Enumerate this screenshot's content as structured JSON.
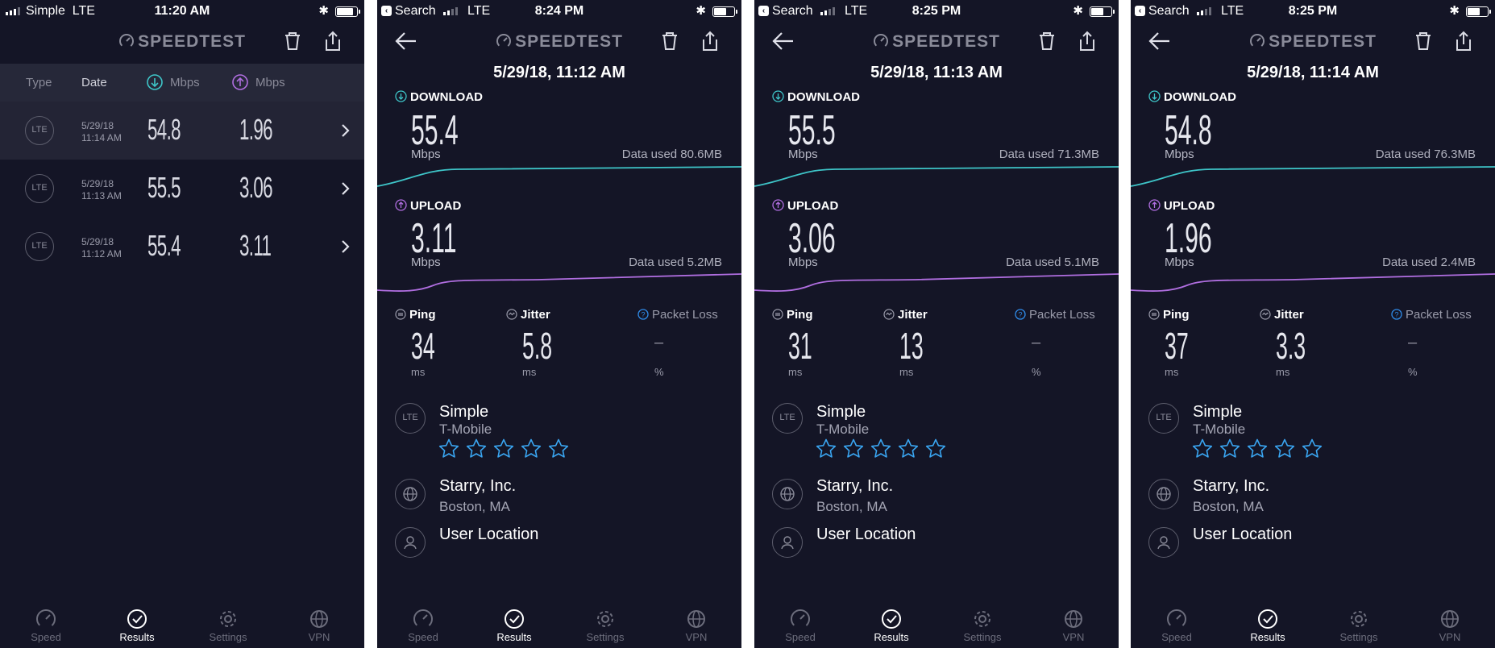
{
  "colors": {
    "background": "#141526",
    "download": "#3ec5c8",
    "upload": "#b06ee0",
    "star": "#3aa6f2",
    "accent": "#2f8be8"
  },
  "app_name": "SPEEDTEST",
  "list_screen": {
    "status": {
      "carrier": "Simple",
      "network": "LTE",
      "time": "11:20 AM"
    },
    "columns": {
      "type": "Type",
      "date": "Date",
      "download": "Mbps",
      "upload": "Mbps"
    },
    "rows": [
      {
        "badge": "LTE",
        "date": "5/29/18",
        "time": "11:14 AM",
        "download": "54.8",
        "upload": "1.96"
      },
      {
        "badge": "LTE",
        "date": "5/29/18",
        "time": "11:13 AM",
        "download": "55.5",
        "upload": "3.06"
      },
      {
        "badge": "LTE",
        "date": "5/29/18",
        "time": "11:12 AM",
        "download": "55.4",
        "upload": "3.11"
      }
    ]
  },
  "details": [
    {
      "status": {
        "back_app": "Search",
        "network": "LTE",
        "time": "8:24 PM"
      },
      "datetime": "5/29/18, 11:12 AM",
      "download_label": "DOWNLOAD",
      "download": "55.4",
      "download_unit": "Mbps",
      "download_data": "Data used 80.6MB",
      "upload_label": "UPLOAD",
      "upload": "3.11",
      "upload_unit": "Mbps",
      "upload_data": "Data used 5.2MB",
      "ping_label": "Ping",
      "ping": "34",
      "ping_unit": "ms",
      "jitter_label": "Jitter",
      "jitter": "5.8",
      "jitter_unit": "ms",
      "loss_label": "Packet Loss",
      "loss": "–",
      "loss_unit": "%",
      "badge": "LTE",
      "carrier": "Simple",
      "carrier_network": "T-Mobile",
      "rating": 5,
      "server": "Starry, Inc.",
      "server_city": "Boston, MA",
      "user_location": "User Location"
    },
    {
      "status": {
        "back_app": "Search",
        "network": "LTE",
        "time": "8:25 PM"
      },
      "datetime": "5/29/18, 11:13 AM",
      "download_label": "DOWNLOAD",
      "download": "55.5",
      "download_unit": "Mbps",
      "download_data": "Data used 71.3MB",
      "upload_label": "UPLOAD",
      "upload": "3.06",
      "upload_unit": "Mbps",
      "upload_data": "Data used 5.1MB",
      "ping_label": "Ping",
      "ping": "31",
      "ping_unit": "ms",
      "jitter_label": "Jitter",
      "jitter": "13",
      "jitter_unit": "ms",
      "loss_label": "Packet Loss",
      "loss": "–",
      "loss_unit": "%",
      "badge": "LTE",
      "carrier": "Simple",
      "carrier_network": "T-Mobile",
      "rating": 5,
      "server": "Starry, Inc.",
      "server_city": "Boston, MA",
      "user_location": "User Location"
    },
    {
      "status": {
        "back_app": "Search",
        "network": "LTE",
        "time": "8:25 PM"
      },
      "datetime": "5/29/18, 11:14 AM",
      "download_label": "DOWNLOAD",
      "download": "54.8",
      "download_unit": "Mbps",
      "download_data": "Data used 76.3MB",
      "upload_label": "UPLOAD",
      "upload": "1.96",
      "upload_unit": "Mbps",
      "upload_data": "Data used 2.4MB",
      "ping_label": "Ping",
      "ping": "37",
      "ping_unit": "ms",
      "jitter_label": "Jitter",
      "jitter": "3.3",
      "jitter_unit": "ms",
      "loss_label": "Packet Loss",
      "loss": "–",
      "loss_unit": "%",
      "badge": "LTE",
      "carrier": "Simple",
      "carrier_network": "T-Mobile",
      "rating": 5,
      "server": "Starry, Inc.",
      "server_city": "Boston, MA",
      "user_location": "User Location"
    }
  ],
  "tabs": [
    {
      "label": "Speed",
      "icon": "speedometer-icon"
    },
    {
      "label": "Results",
      "icon": "check-circle-icon",
      "active": true
    },
    {
      "label": "Settings",
      "icon": "gear-icon"
    },
    {
      "label": "VPN",
      "icon": "globe-lock-icon"
    }
  ]
}
